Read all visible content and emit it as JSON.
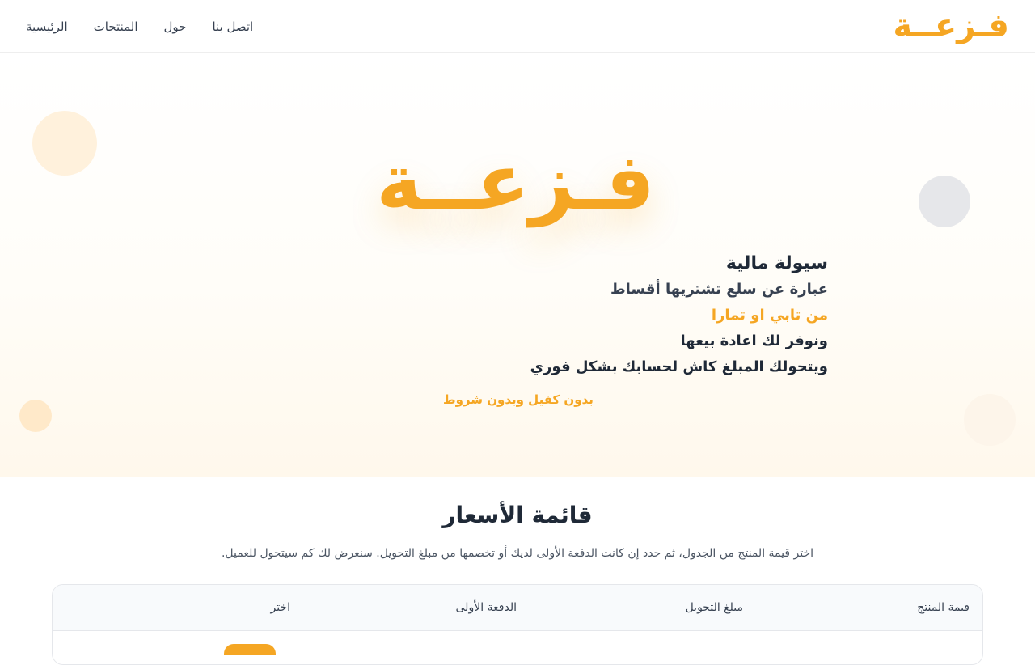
{
  "header": {
    "brand": "فـزعــة",
    "nav": [
      {
        "label": "الرئيسية",
        "name": "nav-home"
      },
      {
        "label": "المنتجات",
        "name": "nav-products"
      },
      {
        "label": "حول",
        "name": "nav-about"
      },
      {
        "label": "اتصل بنا",
        "name": "nav-contact"
      }
    ]
  },
  "hero": {
    "logo": "فـزعــة",
    "title": "سيولة مالية",
    "line1": "عبارة عن سلع تشتريها أقساط",
    "line2": "من تابي او تمارا",
    "line3": "ونوفر لك اعادة بيعها",
    "line4": "ويتحولك المبلغ كاش لحسابك بشكل فوري",
    "note": "بدون كفيل وبدون شروط"
  },
  "prices": {
    "title": "قائمة الأسعار",
    "description": "اختر قيمة المنتج من الجدول، ثم حدد إن كانت الدفعة الأولى لديك أو تخصمها من مبلغ التحويل. سنعرض لك كم سيتحول للعميل.",
    "columns": [
      "قيمة المنتج",
      "مبلغ التحويل",
      "الدفعة الأولى",
      "اختر"
    ]
  },
  "colors": {
    "accent": "#f5a623",
    "text": "#1f2937"
  }
}
